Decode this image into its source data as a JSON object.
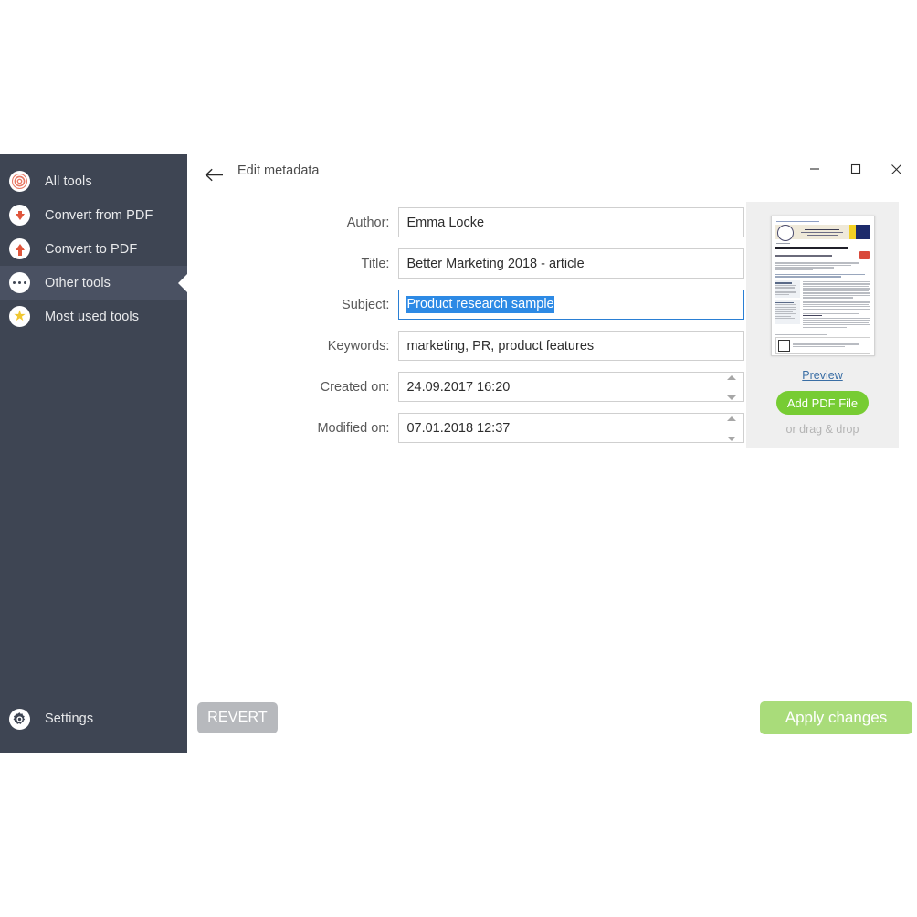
{
  "window": {
    "title": "Edit metadata",
    "back_icon": "back-arrow-icon",
    "controls": {
      "minimize": "—",
      "maximize": "☐",
      "close": "✕"
    }
  },
  "sidebar": {
    "items": [
      {
        "label": "All tools",
        "icon": "spiral-target-icon",
        "selected": false
      },
      {
        "label": "Convert from PDF",
        "icon": "arrow-down-icon",
        "selected": false
      },
      {
        "label": "Convert to PDF",
        "icon": "arrow-up-icon",
        "selected": false
      },
      {
        "label": "Other tools",
        "icon": "ellipsis-dots-icon",
        "selected": true
      },
      {
        "label": "Most used tools",
        "icon": "star-icon",
        "selected": false
      }
    ],
    "settings": {
      "label": "Settings",
      "icon": "gear-icon"
    },
    "background_color": "#3e4553",
    "selected_color": "#4a5162"
  },
  "form": {
    "fields": [
      {
        "label": "Author:",
        "value": "Emma Locke",
        "focused": false,
        "selected": false,
        "spinner": false
      },
      {
        "label": "Title:",
        "value": "Better Marketing 2018 - article",
        "focused": false,
        "selected": false,
        "spinner": false
      },
      {
        "label": "Subject:",
        "value": "Product research sample",
        "focused": true,
        "selected": true,
        "spinner": false
      },
      {
        "label": "Keywords:",
        "value": "marketing, PR, product features",
        "focused": false,
        "selected": false,
        "spinner": false
      },
      {
        "label": "Created on:",
        "value": "24.09.2017 16:20",
        "focused": false,
        "selected": false,
        "spinner": true
      },
      {
        "label": "Modified on:",
        "value": "07.01.2018 12:37",
        "focused": false,
        "selected": false,
        "spinner": true
      }
    ],
    "selection_color": "#2d8ae5",
    "focus_border_color": "#2a7fd4"
  },
  "side_panel": {
    "thumbnail_name": "pdf-page-thumbnail",
    "preview_link": "Preview",
    "add_file_button": "Add PDF File",
    "drag_drop_hint": "or drag & drop",
    "add_button_color": "#77cc33",
    "background_color": "#efefef"
  },
  "footer": {
    "revert_label": "REVERT",
    "apply_label": "Apply changes",
    "revert_color": "#b7b9bd",
    "apply_color": "#a9dc7a"
  }
}
